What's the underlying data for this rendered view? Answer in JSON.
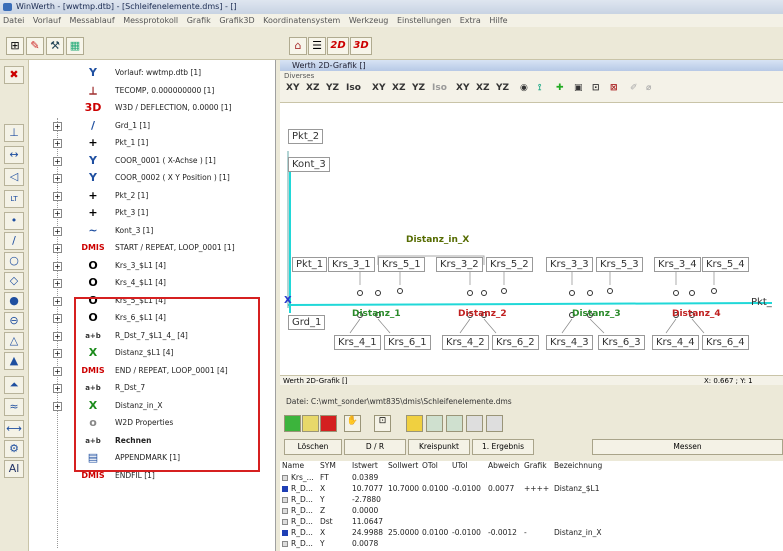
{
  "window_title": "WinWerth - [wwtmp.dtb] - [Schleifenelemente.dms] - []",
  "menu": [
    "Datei",
    "Vorlauf",
    "Messablauf",
    "Messprotokoll",
    "Grafik",
    "Grafik3D",
    "Koordinatensystem",
    "Werkzeug",
    "Einstellungen",
    "Extra",
    "Hilfe"
  ],
  "toolbar_2d": "2D",
  "toolbar_3d": "3D",
  "tree": [
    {
      "icon": "Y",
      "label": "Vorlauf: wwtmp.dtb [1]"
    },
    {
      "icon": "⟂",
      "label": "TECOMP, 0.000000000 [1]"
    },
    {
      "icon": "3D",
      "label": "W3D / DEFLECTION, 0.0000 [1]"
    },
    {
      "icon": "/",
      "label": "Grd_1 [1]"
    },
    {
      "icon": "+",
      "label": "Pkt_1 [1]"
    },
    {
      "icon": "Y",
      "label": "COOR_0001 ( X-Achse ) [1]"
    },
    {
      "icon": "Y",
      "label": "COOR_0002 ( X Y Position ) [1]"
    },
    {
      "icon": "+",
      "label": "Pkt_2 [1]"
    },
    {
      "icon": "+",
      "label": "Pkt_3 [1]"
    },
    {
      "icon": "~",
      "label": "Kont_3 [1]"
    },
    {
      "icon": "DMIS",
      "label": "START / REPEAT, LOOP_0001 [1]"
    },
    {
      "icon": "O",
      "label": "Krs_3_$L1 [4]"
    },
    {
      "icon": "O",
      "label": "Krs_4_$L1 [4]"
    },
    {
      "icon": "O",
      "label": "Krs_5_$L1 [4]"
    },
    {
      "icon": "O",
      "label": "Krs_6_$L1 [4]"
    },
    {
      "icon": "a+b",
      "label": "R_Dst_7_$L1_4_ [4]"
    },
    {
      "icon": "X",
      "label": "Distanz_$L1 [4]"
    },
    {
      "icon": "DMIS",
      "label": "END / REPEAT, LOOP_0001 [4]"
    },
    {
      "icon": "a+b",
      "label": "R_Dst_7"
    },
    {
      "icon": "X",
      "label": "Distanz_in_X"
    },
    {
      "icon": "o",
      "label": "W2D Properties"
    },
    {
      "icon": "a+b",
      "label": "Rechnen"
    },
    {
      "icon": "▤",
      "label": "APPENDMARK [1]"
    },
    {
      "icon": "DMIS",
      "label": "ENDFIL [1]"
    }
  ],
  "grafik": {
    "title": "Werth 2D-Grafik []",
    "subtitle": "Diverses",
    "tool_labels": [
      "XY",
      "XZ",
      "YZ",
      "Iso",
      "XY",
      "XZ",
      "YZ",
      "Iso",
      "XY",
      "XZ",
      "YZ"
    ],
    "points": [
      "Pkt_2",
      "Kont_3",
      "Pkt_1",
      "Krs_3_1",
      "Krs_5_1",
      "Krs_3_2",
      "Krs_5_2",
      "Krs_3_3",
      "Krs_5_3",
      "Krs_3_4",
      "Krs_5_4",
      "Grd_1",
      "Krs_4_1",
      "Krs_6_1",
      "Krs_4_2",
      "Krs_6_2",
      "Krs_4_3",
      "Krs_6_3",
      "Krs_4_4",
      "Krs_6_4",
      "Pkt_"
    ],
    "distanz_in_x": "Distanz_in_X",
    "distances": [
      "Distanz_1",
      "Distanz_2",
      "Distanz_3",
      "Distanz_4"
    ],
    "x_marker": "X",
    "status_left": "Werth 2D-Grafik []",
    "status_right": "X:  0.667 ; Y:  1"
  },
  "panel": {
    "datei": "Datei:  C:\\wmt_sonder\\wmt835\\dmis\\Schleifenelemente.dms",
    "buttons": [
      "Löschen",
      "D / R",
      "Kreispunkt",
      "1. Ergebnis",
      "Messen"
    ],
    "columns": [
      "Name",
      "SYM",
      "Istwert",
      "Sollwert",
      "OTol",
      "UTol",
      "Abweich",
      "Grafik",
      "Bezeichnung"
    ],
    "rows": [
      [
        "Krs_...",
        "FT",
        "0.0389",
        "",
        "",
        "",
        "",
        "",
        ""
      ],
      [
        "R_D...",
        "X",
        "10.7077",
        "10.7000",
        "0.0100",
        "-0.0100",
        "0.0077",
        "++++",
        "Distanz_$L1"
      ],
      [
        "R_D...",
        "Y",
        "-2.7880",
        "",
        "",
        "",
        "",
        "",
        ""
      ],
      [
        "R_D...",
        "Z",
        "0.0000",
        "",
        "",
        "",
        "",
        "",
        ""
      ],
      [
        "R_D...",
        "Dst",
        "11.0647",
        "",
        "",
        "",
        "",
        "",
        ""
      ],
      [
        "R_D...",
        "X",
        "24.9988",
        "25.0000",
        "0.0100",
        "-0.0100",
        "-0.0012",
        "-",
        "Distanz_in_X"
      ],
      [
        "R_D...",
        "Y",
        "0.0078",
        "",
        "",
        "",
        "",
        "",
        ""
      ]
    ]
  }
}
